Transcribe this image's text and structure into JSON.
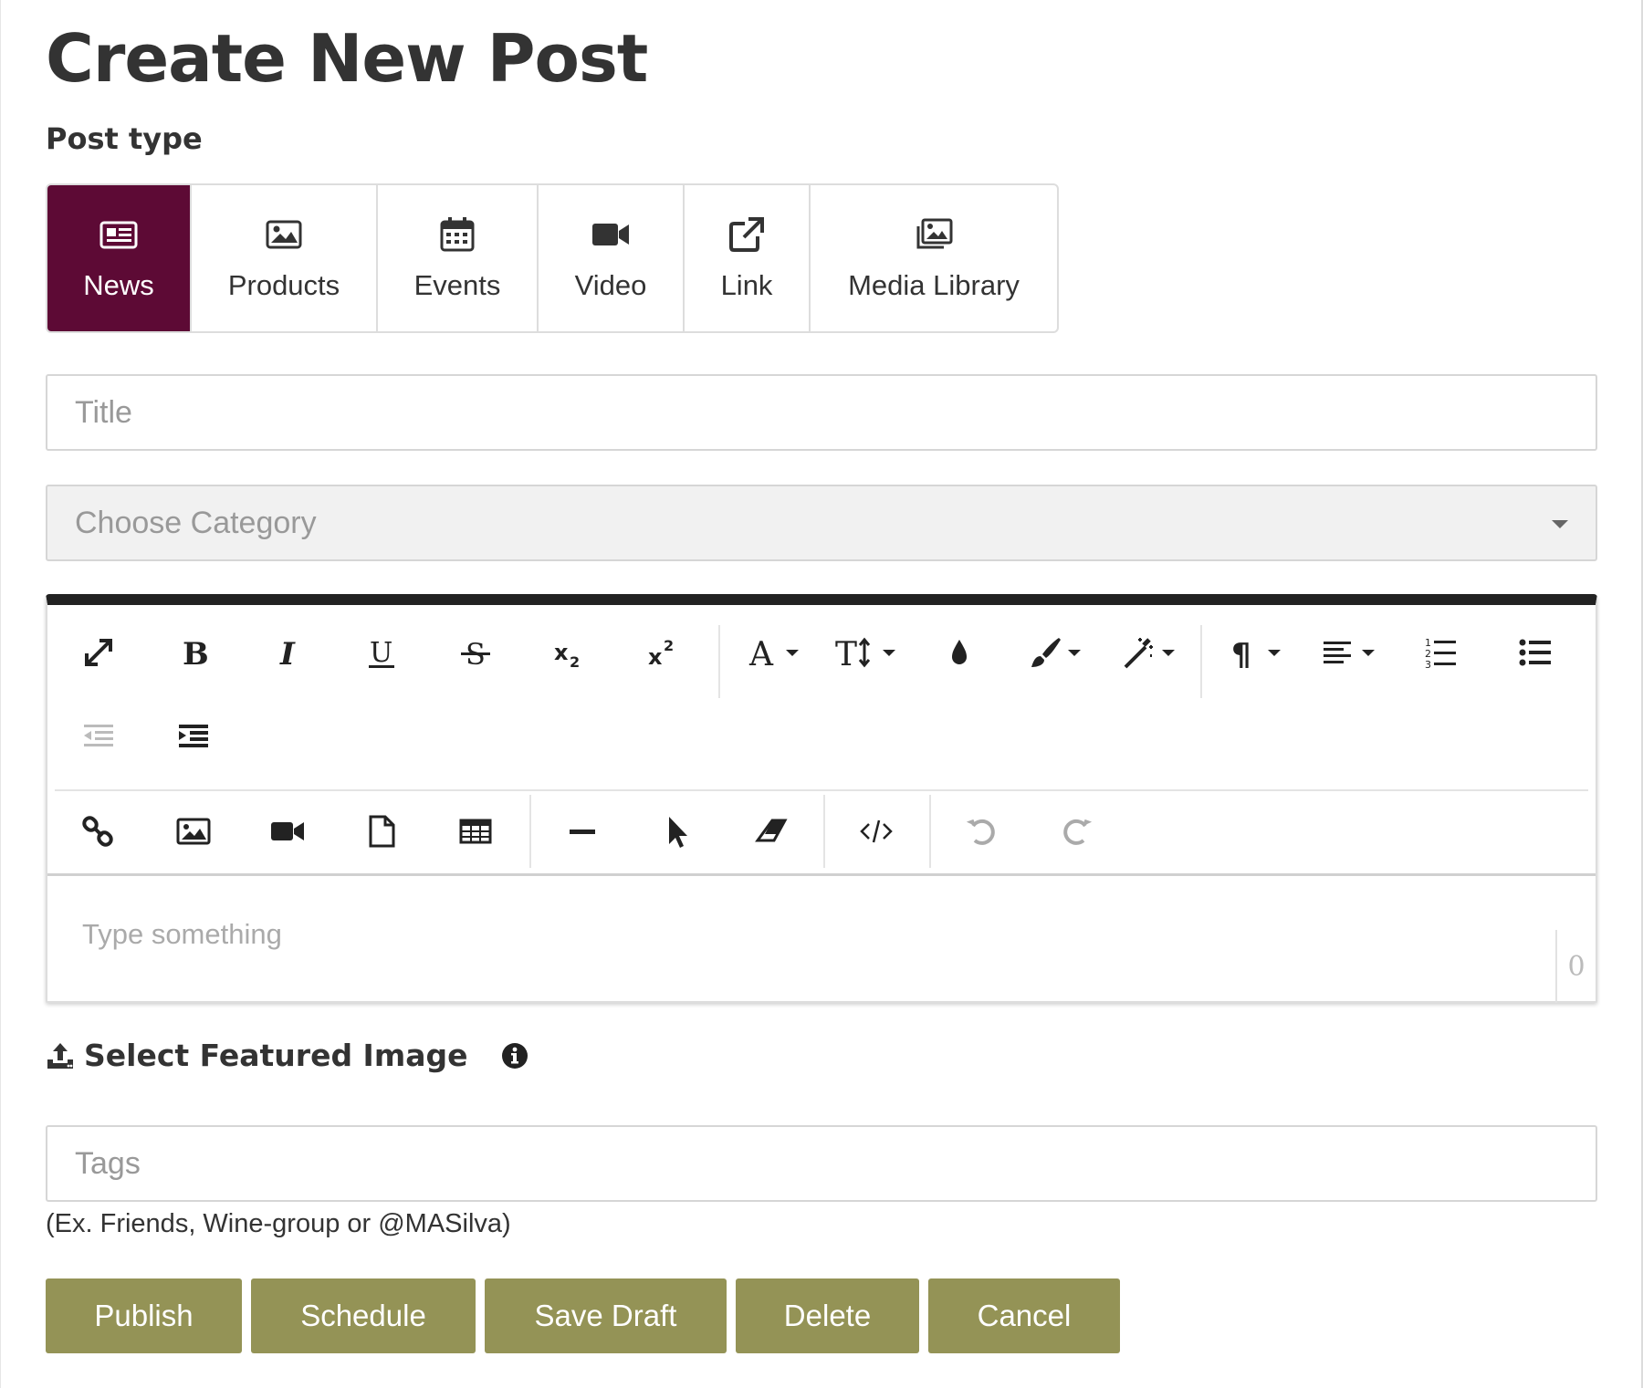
{
  "page": {
    "title": "Create New Post"
  },
  "post_type": {
    "label": "Post type",
    "options": [
      {
        "label": "News",
        "icon": "newspaper-icon",
        "active": true
      },
      {
        "label": "Products",
        "icon": "image-icon"
      },
      {
        "label": "Events",
        "icon": "calendar-icon"
      },
      {
        "label": "Video",
        "icon": "video-camera-icon"
      },
      {
        "label": "Link",
        "icon": "external-link-icon"
      },
      {
        "label": "Media Library",
        "icon": "images-stack-icon"
      }
    ]
  },
  "title_input": {
    "placeholder": "Title",
    "value": ""
  },
  "category_select": {
    "placeholder": "Choose Category",
    "selected": ""
  },
  "editor": {
    "placeholder": "Type something",
    "char_count": "0",
    "toolbar_row1": [
      "fullscreen-icon",
      "bold-icon",
      "italic-icon",
      "underline-icon",
      "strikethrough-icon",
      "subscript-icon",
      "superscript-icon",
      "font-family-icon",
      "font-size-icon",
      "text-color-icon",
      "background-color-icon",
      "inline-style-icon",
      "paragraph-format-icon",
      "align-icon",
      "ordered-list-icon",
      "unordered-list-icon",
      "outdent-icon",
      "indent-icon"
    ],
    "toolbar_row2": [
      "insert-link-icon",
      "insert-image-icon",
      "insert-video-icon",
      "insert-file-icon",
      "insert-table-icon",
      "horizontal-line-icon",
      "select-all-icon",
      "clear-formatting-icon",
      "code-view-icon",
      "undo-icon",
      "redo-icon"
    ]
  },
  "featured_image": {
    "label": "Select Featured Image"
  },
  "tags_input": {
    "placeholder": "Tags",
    "value": "",
    "hint": "(Ex. Friends, Wine-group or @MASilva)"
  },
  "actions": {
    "publish": "Publish",
    "schedule": "Schedule",
    "save_draft": "Save Draft",
    "delete": "Delete",
    "cancel": "Cancel"
  },
  "colors": {
    "accent": "#5d0a35",
    "button": "#949356",
    "toolbar_top": "#222222"
  }
}
